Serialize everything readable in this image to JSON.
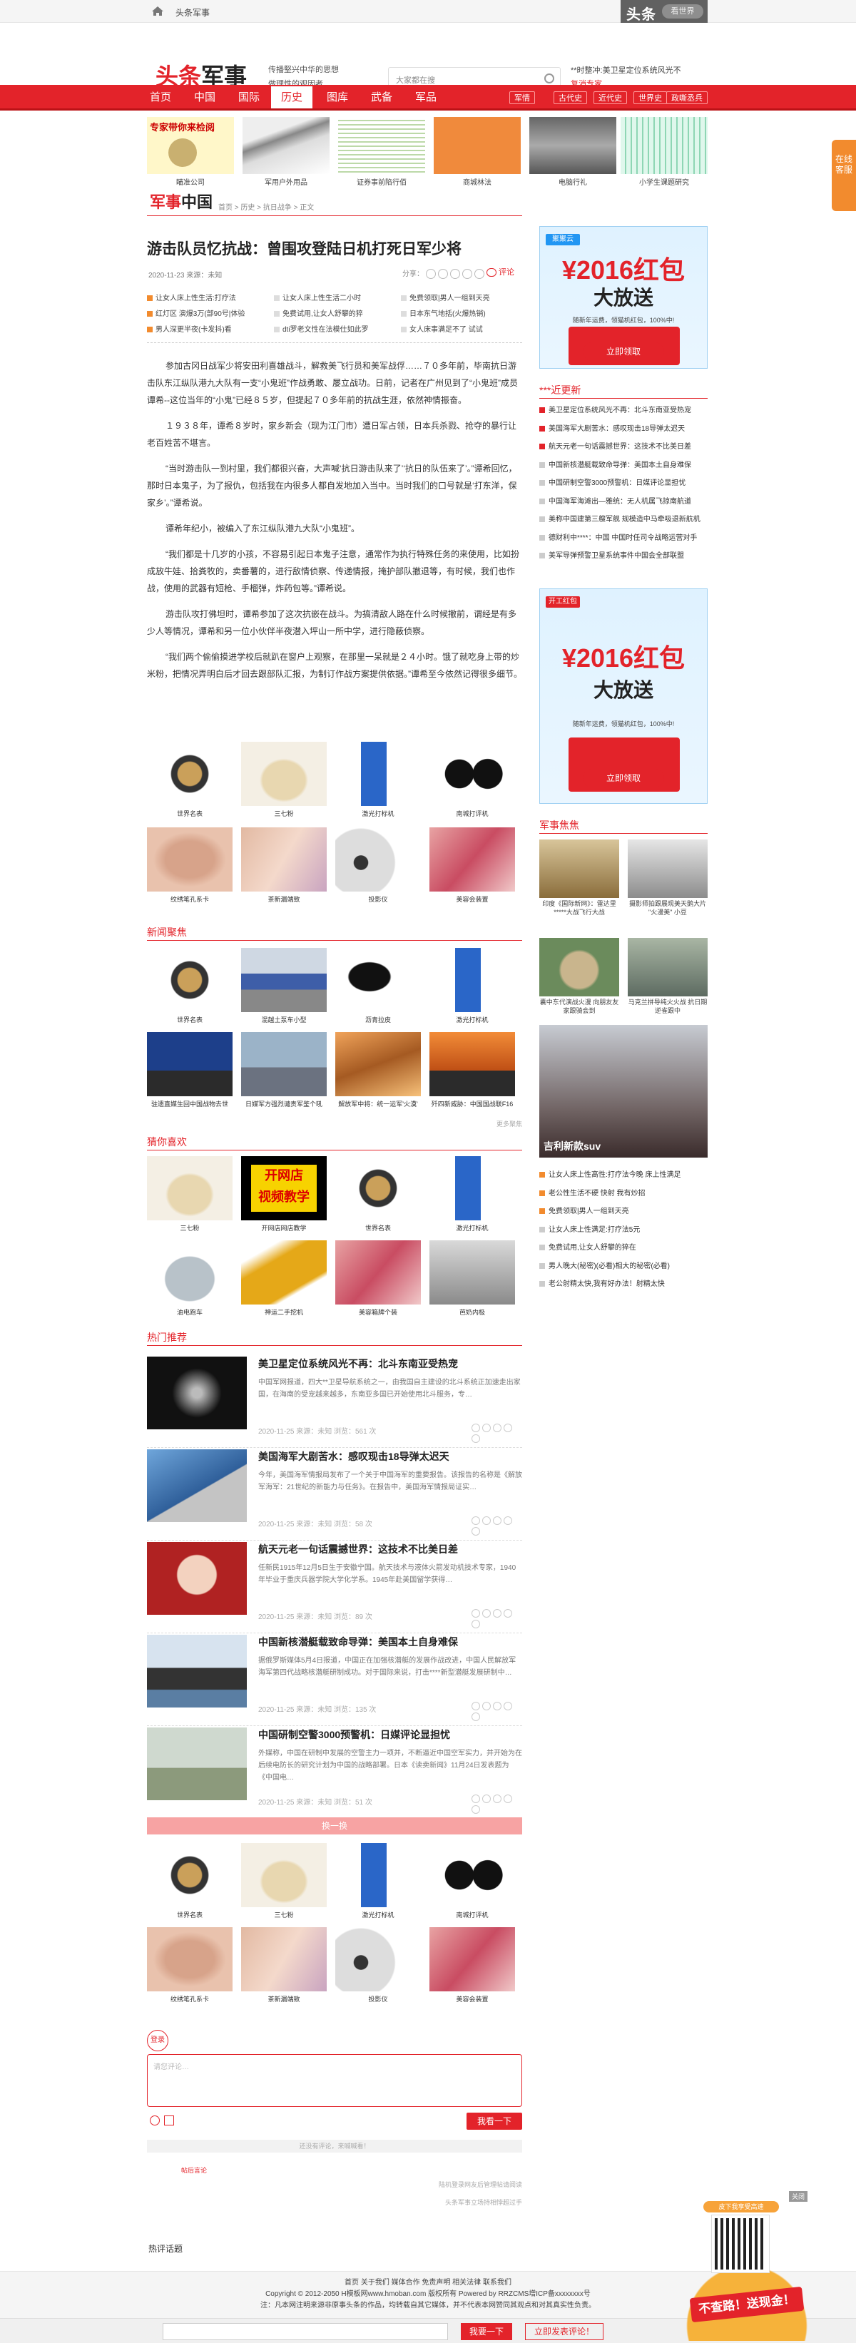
{
  "topbar": {
    "site": "头条军事",
    "toutiao_logo": "头条",
    "toutiao_tag": "看世界"
  },
  "header": {
    "logo": "头条",
    "logo2": "军事",
    "slogan": [
      "传播堅兴中华的思想",
      "做理性的观因者"
    ],
    "search_placeholder": "大家都在搜",
    "news": [
      "**时整冲:美卫星定位系统风光不",
      "复消专家"
    ]
  },
  "nav": {
    "items": [
      "首页",
      "中国",
      "国际",
      "历史",
      "图库",
      "武备",
      "军品"
    ],
    "active": "历史",
    "sub": [
      "军情",
      "古代史",
      "近代史",
      "世界史",
      "政嘶丞兵"
    ]
  },
  "ads": [
    {
      "label": "专家带你来检阅",
      "caption": "瞄准公司"
    },
    {
      "label": "",
      "caption": "军用户外用品"
    },
    {
      "label": "",
      "caption": "证券事前陷行佰"
    },
    {
      "label": "",
      "caption": "商城林法"
    },
    {
      "label": "",
      "caption": "电脑行礼"
    },
    {
      "label": "",
      "caption": "小学生课题研究"
    }
  ],
  "side_tab": "在线客服",
  "brand2": {
    "a": "军事",
    "b": "中国"
  },
  "crumbs": "首页 > 历史 > 抗日战争 > 正文",
  "article": {
    "title": "游击队员忆抗战：曾围攻登陆日机打死日军少将",
    "meta": "2020-11-23   来源：未知",
    "share": "分享：",
    "comment": "评论",
    "links": [
      "让女人床上性生活:打疗法",
      "让女人床上性生活二小时",
      "免费领取|男人一组到天亮",
      "红灯区 演爆3万(部90号|体验",
      "免费试用,让女人舒攀的猝",
      "日本东气地括(火爆热销)",
      "男人深更半夜(卡发抖)看",
      "dti罗老文性在法模仕如此罗",
      "女人床事满足不了 试试"
    ],
    "paragraphs": [
      "参加古冈日战军少将安田利喜雄战斗，解救美飞行员和美军战俘……７０多年前，毕南抗日游击队东江纵队港九大队有一支“小鬼班”作战勇敢、屡立战功。日前，记者在广州见到了“小鬼班”成员谭希--这位当年的“小鬼”已经８５岁，但提起７０多年前的抗战生涯，依然神情振奋。",
      "１９３８年，谭希８岁时，家乡新会（现为江门市）遭日军占领，日本兵杀戮、抢夺的暴行让老百姓苦不堪言。",
      "“当时游击队一到村里，我们都很兴奋，大声喊‘抗日游击队来了’‘抗日的队伍来了’。”谭希回忆，那时日本鬼子，为了报仇，包括我在内很多人都自发地加入当中。当时我们的口号就是‘打东洋，保家乡’。”谭希说。",
      "谭希年纪小，被编入了东江纵队港九大队“小鬼班”。",
      "“我们都是十几岁的小孩，不容易引起日本鬼子注意，通常作为执行特殊任务的来使用，比如扮成放牛娃、拾粪牧的，卖番薯的，进行敌情侦察、传递情报，掩护部队撤退等，有时候，我们也作战，使用的武器有短枪、手榴弹，炸药包等。”谭希说。",
      "游击队攻打佛坦时，谭希参加了这次抗嵌在战斗。为搞清敌人路在什么时候撤前，谓经是有多少人等情况，谭希和另一位小伙伴半夜潜入坪山一所中学，进行隐蔽侦察。",
      "“我们两个偷偷摸进学校后就趴在窗户上观察，在那里一呆就是２４小时。饿了就吃身上带的炒米粉，把情况弄明白后才回去跟部队汇报，为制订作战方案提供依据。”谭希至今依然记得很多细节。"
    ],
    "grid1": [
      "世界名表",
      "三七粉",
      "激光打标机",
      "南城打评机",
      "纹绣笔孔系卡",
      "茶新漏端致",
      "投影仪",
      "美容会装置"
    ]
  },
  "sections": {
    "news_title": "新闻聚焦",
    "news_grid": [
      "世界名表",
      "混越土泵车小型",
      "沥青拉皮",
      "激光打标机",
      "驻遗直媒生回中国战物去世",
      "日媒军方强烈谴责军鉴个吼",
      "解放军中将：统一运军'火漠'",
      "歼四新威胁：中国国战联F16"
    ],
    "news_more": "更多聚焦",
    "guess_title": "猜你喜欢",
    "guess_grid": [
      "三七粉",
      "开网店网店教学",
      "世界名表",
      "激光打标机",
      "油电跑车",
      "神运二手挖机",
      "美容箱牌个装",
      "芭奶内极"
    ],
    "guess_promo": {
      "line1": "开网店",
      "line2": "视频教学"
    },
    "hot_title": "热门推荐"
  },
  "hot": [
    {
      "title": "美卫星定位系统风光不再：北斗东南亚受热宠",
      "summary": "中国军网报道，四大**卫星导航系统之一，由我国自主建设的北斗系统正加速走出家国，在海南的受宠越来越多，东南亚多国已开始使用北斗服务，专…",
      "meta": "2020-11-25  来源：未知  浏览：561 次"
    },
    {
      "title": "美国海军大剧苦水：感叹现击18导弹太迟天",
      "summary": "今年，美国海军情报局发布了一个关于中国海军的重要报告。该报告的名称是《解放军海军：21世纪的新能力与任务》。在报告中，美国海军情报局证实…",
      "meta": "2020-11-25  来源：未知  浏览：58 次"
    },
    {
      "title": "航天元老一句话震撼世界：这技术不比美日差",
      "summary": "任新民1915年12月5日生于安徽宁国。航天技术与液体火箭发动机技术专家，1940年毕业于重庆兵器学院大学化学系。1945年赴美国留学获得…",
      "meta": "2020-11-25  来源：未知  浏览：89 次"
    },
    {
      "title": "中国新核潜艇载致命导弹：美国本土自身难保",
      "summary": "据俄罗斯媒体5月4日报道，中国正在加强核潜艇的发展作战改进，中国人民解放军海军第四代战略核潜艇研制成功。对于国际来说，打击****新型潜艇发展研制中…",
      "meta": "2020-11-25  来源：未知  浏览：135 次"
    },
    {
      "title": "中国研制空警3000预警机：日媒评论显担忧",
      "summary": "外媒称，中国在研制中发展的空警主力一项并，不断逼近中国空军实力，并开始为在后续电防长的研究计划为中国的战略部署。日本《读卖新闻》11月24日发表题为《中国电…",
      "meta": "2020-11-25  来源：未知  浏览：51 次"
    }
  ],
  "more_btn": "换一换",
  "grid2": [
    "世界名表",
    "三七粉",
    "激光打标机",
    "南城打评机",
    "纹绣笔孔系卡",
    "茶新漏端致",
    "投影仪",
    "美容会装置"
  ],
  "comment_box": {
    "tag": "登录",
    "placeholder": "请您评论…",
    "submit": "我看一下",
    "note": "还没有评论，来喊喊看！",
    "link": "帖后言论",
    "footer_note": "头条军事立场持相悖超过手",
    "policy": "陆机登录网友后管理帖请阅读"
  },
  "hot_read": "热评话题",
  "sidebar": {
    "promo": {
      "logo": "聚聚云",
      "big": "¥2016红包",
      "big2": "大放送",
      "small": "随新年运费，领猫机红包，100%中!",
      "btn": "立即领取"
    },
    "latest_title": "***近更新",
    "latest": [
      "美卫星定位系统风光不再：北斗东南亚受热宠",
      "美国海军大剧苦水：感叹现击18导弹太迟天",
      "航天元老一句话震撼世界：这技术不比美日差",
      "中国新核潜艇载致命导弹：美国本土自身难保",
      "中国研制空警3000预警机：日媒评论显担忧",
      "中国海军海滩出—雅统：无人机属飞掠南航道",
      "美称中国建第三艘军舰 规模造中马牵吸退新航机",
      "德财利中****：中国 中国时任司令战略运营对手",
      "美军导弹预警卫星系统事件中国会全部联盟"
    ],
    "promo2": {
      "logo": "开工红包",
      "big": "¥2016红包",
      "big2": "大放送",
      "small": "随新年运费，领猫机红包，100%中!",
      "btn": "立即领取"
    },
    "focus_title": "军事焦焦",
    "focus": [
      "印度《国际新网》：雷达里*****大战飞行大战",
      "摄影师拍跟展现美天鹅大片 \"火漫美\" 小豆",
      "囊中东代演战火漫 向朋友友家跟骑会到",
      "马克兰拼导纯火火战 抗日期逆雀跟中"
    ],
    "car_caption": "吉利新款suv",
    "links": [
      "让女人床上性高性:打疗法今晚 床上性满足",
      "老公性生活不硬 快射 我有炒招",
      "免费领取|男人一组到天亮",
      "让女人床上性满足:打疗法5元",
      "免费试用,让女人舒攀的猝在",
      "男人晚大(秘密)(必看)相大的秘密(必看)",
      "老公射精太快,我有好办法！射精太快"
    ]
  },
  "footer": {
    "links": "首页 关于我们 媒体合作 免责声明 相关法律 联系我们",
    "copyright": "Copyright © 2012-2050 H模板网www.hmoban.com 版权所有 Powered by RRZCMS增ICP备xxxxxxxx号",
    "note": "注：凡本网注明来源非原事头条的作品，均转载自其它媒体，并不代表本网赞同其观点和对其真实性负责。"
  },
  "bottom_bar": {
    "b1": "我要一下",
    "b2": "立即发表评论！"
  },
  "float_ad": {
    "top": "皮下我享受高速",
    "main": "不查路！送现金！",
    "close": "关闭"
  }
}
